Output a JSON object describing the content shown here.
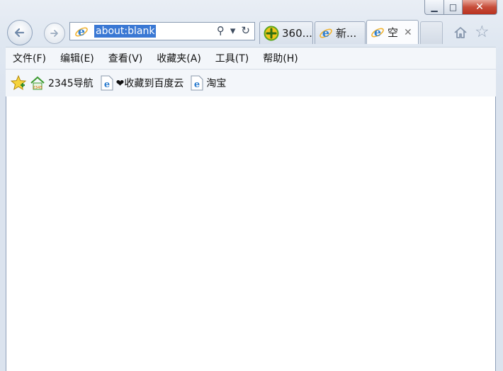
{
  "window": {
    "minimize_glyph": "▁",
    "maximize_glyph": "□",
    "close_glyph": "✕"
  },
  "nav": {
    "back_icon": "back-arrow-icon",
    "forward_icon": "forward-arrow-icon",
    "address": "about:blank",
    "search_glyph": "⚲",
    "dropdown_glyph": "▾",
    "refresh_glyph": "↻"
  },
  "tabs": [
    {
      "label": "360...",
      "icon": "360-browser-icon"
    },
    {
      "label": "新...",
      "icon": "ie-icon"
    },
    {
      "label": "空",
      "icon": "ie-icon",
      "active": true,
      "close_glyph": "✕"
    }
  ],
  "menu": [
    "文件(F)",
    "编辑(E)",
    "查看(V)",
    "收藏夹(A)",
    "工具(T)",
    "帮助(H)"
  ],
  "favorites": [
    {
      "label": "2345导航",
      "icon": "house-2345-icon"
    },
    {
      "label": "❤收藏到百度云",
      "icon": "ie-page-icon"
    },
    {
      "label": "淘宝",
      "icon": "ie-page-icon"
    }
  ],
  "colors": {
    "address_highlight": "#3a78d4",
    "close_button": "#c74d3a",
    "ie_blue": "#2f7fd0",
    "ie_ring": "#f2b431"
  }
}
